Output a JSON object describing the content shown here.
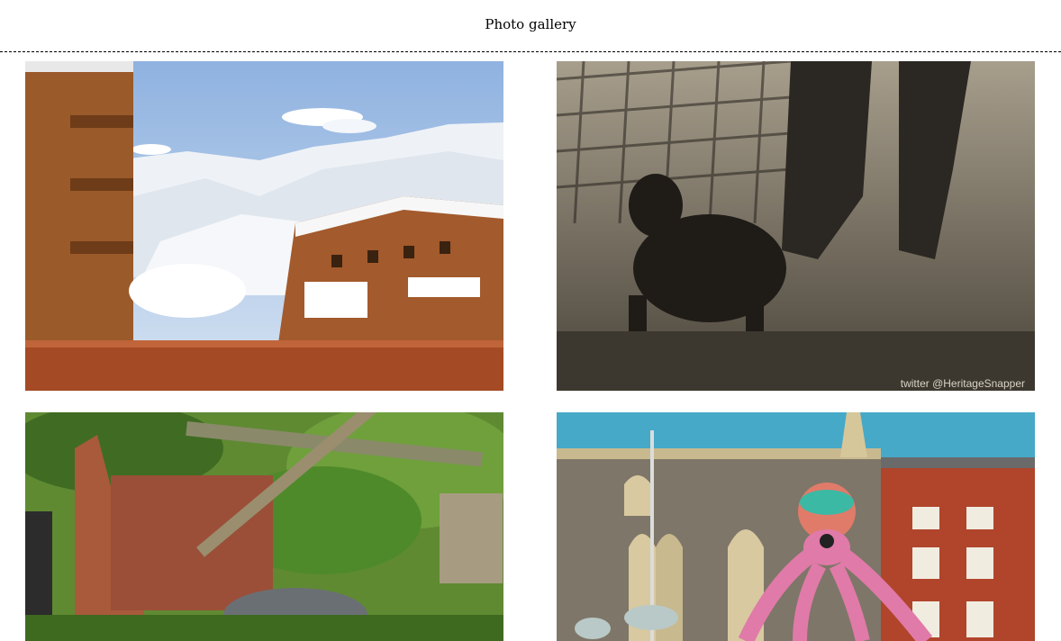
{
  "page": {
    "title": "Photo gallery"
  },
  "gallery": {
    "photos": [
      {
        "subject": "snowy-mountain-chalets"
      },
      {
        "subject": "dog-sprinkler-sepia",
        "watermark": "twitter @HeritageSnapper"
      },
      {
        "subject": "collapsed-shed-overgrown"
      },
      {
        "subject": "octopus-sculpture-old-building"
      }
    ]
  },
  "colors": {
    "sky_blue": "#a9c4e6",
    "wood_brown": "#8a4a22",
    "sepia": "#6b6457",
    "foliage_green": "#4f7f2a",
    "brick_red": "#b0452c",
    "octopus_pink": "#e07aa8"
  }
}
